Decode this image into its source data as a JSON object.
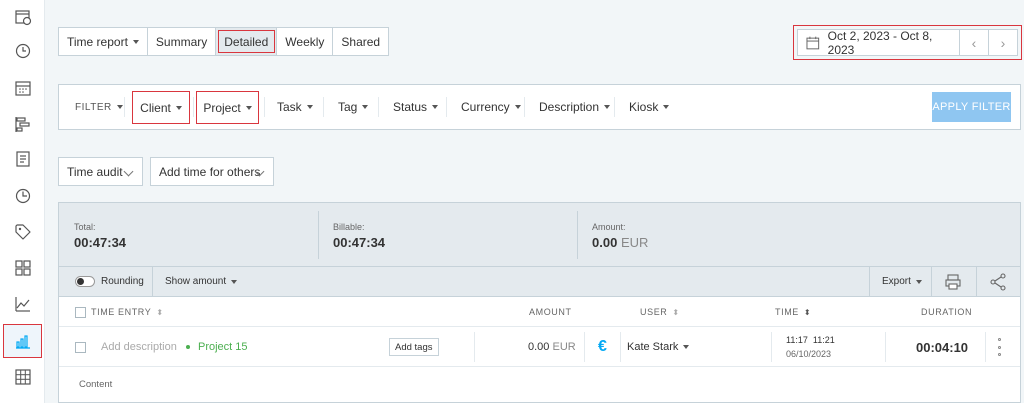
{
  "sidebar": {
    "items": [
      {
        "icon": "calendar-clock-icon"
      },
      {
        "icon": "clock-icon"
      },
      {
        "icon": "calendar-icon"
      },
      {
        "icon": "gantt-icon"
      },
      {
        "icon": "timesheet-icon"
      },
      {
        "icon": "time-off-icon"
      },
      {
        "icon": "tag-icon"
      },
      {
        "icon": "grid-icon"
      },
      {
        "icon": "analytics-icon"
      },
      {
        "icon": "reports-icon",
        "active": true
      },
      {
        "icon": "table-icon"
      }
    ]
  },
  "report_tabs": {
    "time_report": "Time report",
    "summary": "Summary",
    "detailed": "Detailed",
    "weekly": "Weekly",
    "shared": "Shared"
  },
  "date_range": {
    "label": "Oct 2, 2023 - Oct 8, 2023",
    "prev": "‹",
    "next": "›"
  },
  "filters": {
    "label": "FILTER",
    "client": "Client",
    "project": "Project",
    "task": "Task",
    "tag": "Tag",
    "status": "Status",
    "currency": "Currency",
    "description": "Description",
    "kiosk": "Kiosk",
    "apply": "APPLY FILTER"
  },
  "dropdowns": {
    "time_audit": "Time audit",
    "add_time": "Add time for others"
  },
  "summary": {
    "total_label": "Total:",
    "total_value": "00:47:34",
    "billable_label": "Billable:",
    "billable_value": "00:47:34",
    "amount_label": "Amount:",
    "amount_value": "0.00",
    "amount_currency": "EUR"
  },
  "toolbar": {
    "rounding": "Rounding",
    "show_amount": "Show amount",
    "export": "Export"
  },
  "table": {
    "headers": {
      "time_entry": "TIME ENTRY",
      "amount": "AMOUNT",
      "user": "USER",
      "time": "TIME",
      "duration": "DURATION"
    },
    "row": {
      "description": "Add description",
      "project": "Project 15",
      "add_tags": "Add tags",
      "amount": "0.00",
      "currency": "EUR",
      "currency_symbol": "€",
      "user": "Kate Stark",
      "time_range": "11:17  11:21",
      "date": "06/10/2023",
      "duration": "00:04:10"
    },
    "content_label": "Content"
  },
  "colors": {
    "accent": "#03a9f4",
    "highlight": "#d9363e",
    "project": "#4caf50",
    "apply_button": "#8fc6f1"
  }
}
